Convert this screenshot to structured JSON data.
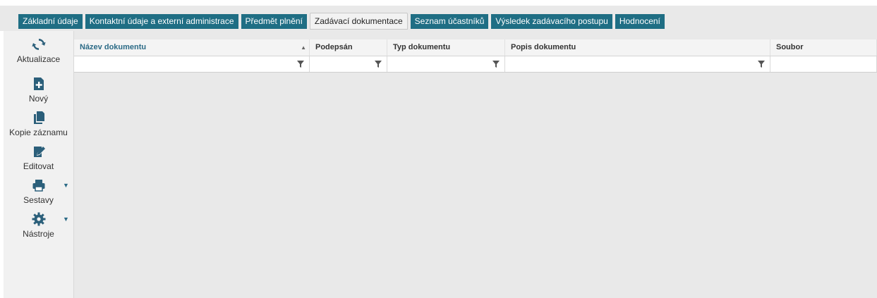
{
  "tabs": [
    {
      "label": "Základní údaje",
      "active": false
    },
    {
      "label": "Kontaktní údaje a externí administrace",
      "active": false
    },
    {
      "label": "Předmět plnění",
      "active": false
    },
    {
      "label": "Zadávací dokumentace",
      "active": true
    },
    {
      "label": "Seznam účastníků",
      "active": false
    },
    {
      "label": "Výsledek zadávacího postupu",
      "active": false
    },
    {
      "label": "Hodnocení",
      "active": false
    }
  ],
  "toolbar": {
    "refresh": {
      "label": "Aktualizace",
      "icon": "refresh-icon"
    },
    "new": {
      "label": "Nový",
      "icon": "new-document-icon"
    },
    "copy": {
      "label": "Kopie záznamu",
      "icon": "copy-icon"
    },
    "edit": {
      "label": "Editovat",
      "icon": "edit-icon"
    },
    "reports": {
      "label": "Sestavy",
      "icon": "printer-icon"
    },
    "tools": {
      "label": "Nástroje",
      "icon": "gear-icon"
    }
  },
  "grid": {
    "columns": [
      {
        "label": "Název dokumentu",
        "sorted": "asc"
      },
      {
        "label": "Podepsán"
      },
      {
        "label": "Typ dokumentu"
      },
      {
        "label": "Popis dokumentu"
      },
      {
        "label": "Soubor"
      }
    ],
    "sort_indicator": "▲",
    "rows": []
  },
  "colors": {
    "tab_bg": "#1f6e84",
    "tab_active_bg": "#f2f2f2",
    "icon": "#2b5f7a",
    "sorted_header": "#2b6a86",
    "grid_bg": "#e9e9e9"
  }
}
